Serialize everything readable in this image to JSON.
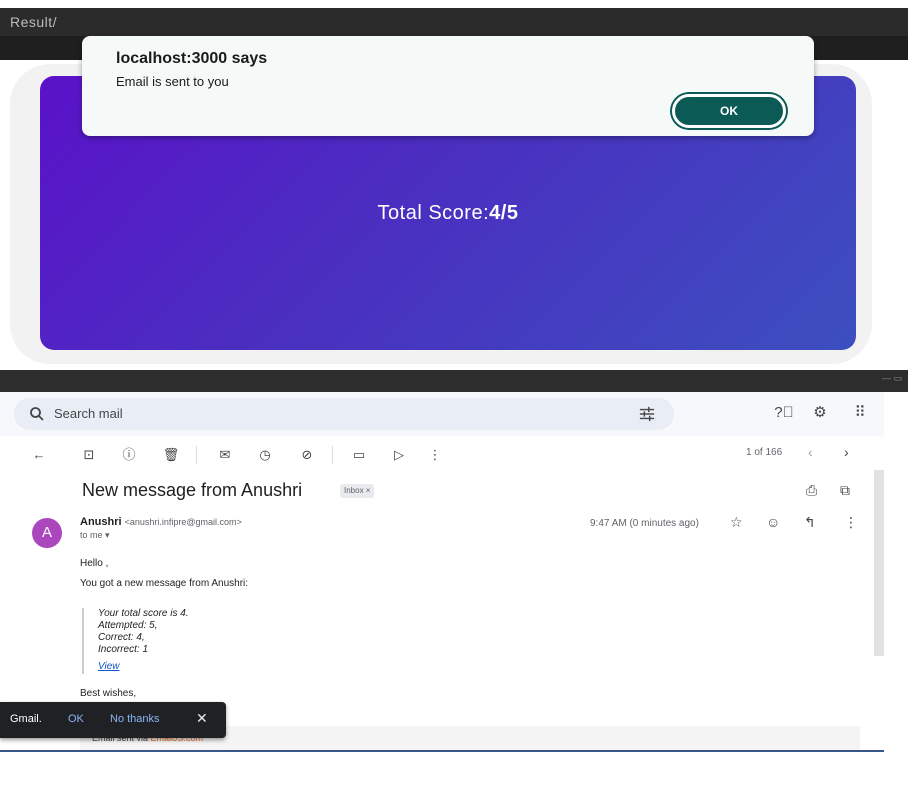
{
  "result_page": {
    "breadcrumb": "Result/",
    "score_label": "Total Score:",
    "score_value": "4/5"
  },
  "alert": {
    "title": "localhost:3000 says",
    "message": "Email is sent to you",
    "ok_label": "OK"
  },
  "gmail": {
    "search_placeholder": "Search mail",
    "pager": "1 of 166",
    "subject": "New message from Anushri",
    "label_chip": "Inbox ×",
    "avatar_letter": "A",
    "sender_name": "Anushri",
    "sender_email": "<anushri.infipre@gmail.com>",
    "to_me": "to me ▾",
    "time": "9:47 AM (0 minutes ago)",
    "greeting": "Hello ,",
    "intro": "You got a new message from Anushri:",
    "quote_lines": [
      "Your total score is 4.",
      "Attempted: 5,",
      "Correct: 4,",
      "Incorrect: 1"
    ],
    "view_link": "View",
    "closing": "Best wishes,",
    "footer_prefix": "Email sent via ",
    "footer_brand": "EmailJS.com"
  },
  "toast": {
    "brand": "Gmail.",
    "ok_label": "OK",
    "no_label": "No thanks",
    "close": "✕"
  },
  "colors": {
    "card_gradient_start": "#5a12c9",
    "card_gradient_end": "#3c4fbf",
    "ok_button": "#0b5a56",
    "avatar": "#ab47bc",
    "link": "#1155cc",
    "emailjs": "#f37021"
  }
}
